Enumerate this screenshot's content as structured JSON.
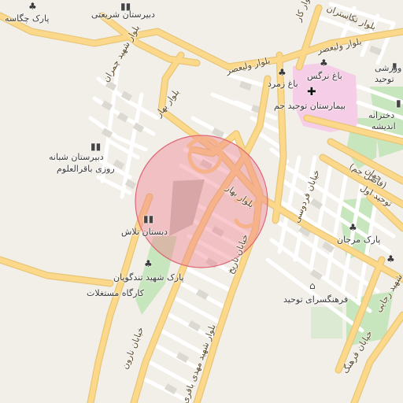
{
  "map": {
    "places": {
      "park_chegase": "پارک چگاسه",
      "school_shariati": "دبیرستان شریعتی",
      "school_shabaneh_line1": "دبیرستان شبانه",
      "school_shabaneh_line2": "روزی باقرالعلوم",
      "school_talash": "دبستان تلاش",
      "park_tondgooyan": "پارک شهید تندگویان",
      "workshop_mostaghelat": "کارگاه مستغلات",
      "bagh_narges": "باغ نرگس",
      "bagh_zomorod": "باغ زمرد",
      "hospital_tohid": "بیمارستان توحید جم",
      "school_varzeshi_line1": "ورزشی",
      "school_varzeshi_line2": "توحید",
      "school_girls_line1": "دخترانه",
      "school_girls_line2": "اندیشه",
      "park_marjan": "پارک مرجان",
      "farhangsara_tohid": "فرهنگسرای توحید"
    },
    "roads": {
      "nikgostar": "بلوار نکاستران",
      "kar": "بلوار کار",
      "valiasr_1": "بلوار ولیعصر",
      "valiasr_2": "بلوار ولیعصر",
      "shahid_jamran": "بلوار شهید چمران",
      "bahar_1": "بلوار بهار",
      "bahar_2": "بلوار بهار",
      "jahan": "جهان",
      "tohid_avval": "توحید اول",
      "fazel_jam": "(فاضل جم)",
      "ferdowsi": "خیابان فردوسی",
      "tarikh": "خیابان تاریخ",
      "naroon": "خیابان نارون",
      "shahid_mahdi_bagheri": "بلوار شهید مهدی باقری",
      "farhang": "خیابان فرهنگ",
      "shahid_rajaei": "شهید رجایی"
    },
    "icons": {
      "tree": "tree-icon",
      "school": "school-icon",
      "hospital": "hospital-icon",
      "museum": "museum-icon"
    },
    "colors": {
      "background": "#f2efe9",
      "road_major": "#fcd98a",
      "road_minor": "#ffffff",
      "building": "#d6d2cc",
      "park": "#bfe2b4",
      "hospital_area": "#f4cbe3",
      "highlight_circle": "#ef7f8c"
    }
  }
}
